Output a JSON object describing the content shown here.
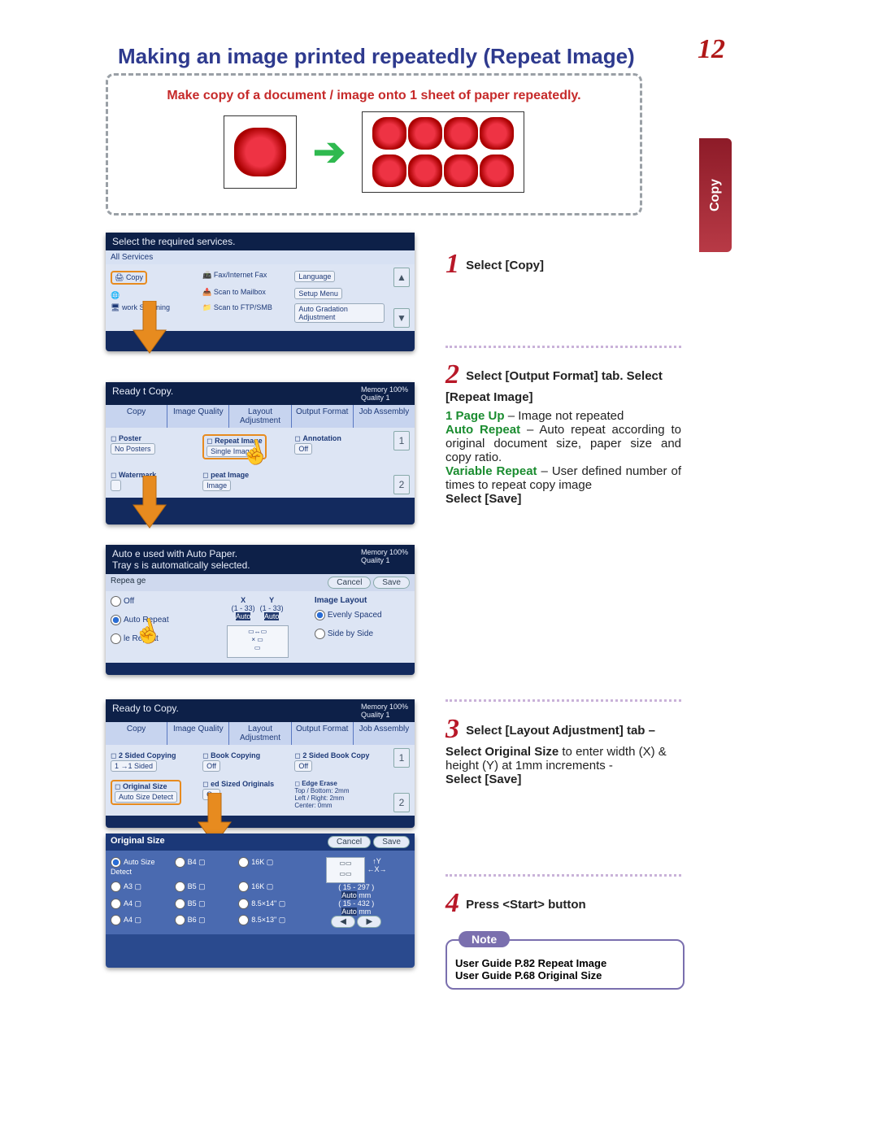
{
  "title": "Making an image printed repeatedly (Repeat Image)",
  "page_number": "12",
  "side_tab": "Copy",
  "dashed_box": {
    "heading": "Make copy of a document / image onto 1 sheet of paper repeatedly."
  },
  "panel1": {
    "header": "Select the required services.",
    "all_services": "All Services",
    "items": {
      "copy": "Copy",
      "fax": "Fax/Internet Fax",
      "language": "Language",
      "scan_mailbox": "Scan to Mailbox",
      "setup": "Setup Menu",
      "network_scan": "work Scanning",
      "scan_ftp": "Scan to FTP/SMB",
      "auto_grad": "Auto Gradation Adjustment"
    }
  },
  "panel2": {
    "header_left": "Ready t   Copy.",
    "header_right": "Memory 100%",
    "header_quality": "Quality    1",
    "tabs": [
      "Copy",
      "Image Quality",
      "Layout Adjustment",
      "Output Format",
      "Job Assembly"
    ],
    "poster": {
      "label": "Poster",
      "value": "No Posters"
    },
    "repeat_image": {
      "label": "Repeat Image",
      "value": "Single Image"
    },
    "annotation": {
      "label": "Annotation",
      "value": "Off"
    },
    "watermark": {
      "label": "Watermark"
    },
    "repeat_image2": {
      "label": "peat Image",
      "value": "Image"
    }
  },
  "panel3": {
    "header_left": "Auto          e used with Auto Paper.",
    "header_left2": "Tray s        is automatically selected.",
    "header_right": "Memory 100%",
    "header_quality": "Quality    1",
    "title_row": "Repea      ge",
    "cancel": "Cancel",
    "save": "Save",
    "x_label": "X",
    "x_range": "(1 - 33)",
    "x_value": "Auto",
    "y_label": "Y",
    "y_range": "(1 - 33)",
    "y_value": "Auto",
    "layout_label": "Image Layout",
    "off": "Off",
    "auto_repeat": "Auto Repeat",
    "le_repeat": "le Repeat",
    "evenly": "Evenly Spaced",
    "side": "Side by Side"
  },
  "panel4": {
    "header_left": "Ready to Copy.",
    "header_right": "Memory 100%",
    "header_quality": "Quality    1",
    "tabs": [
      "Copy",
      "Image Quality",
      "Layout Adjustment",
      "Output Format",
      "Job Assembly"
    ],
    "two_sided": {
      "label": "2 Sided Copying",
      "value": "1 →1 Sided"
    },
    "book": {
      "label": "Book Copying",
      "value": "Off"
    },
    "two_sided_book": {
      "label": "2 Sided Book Copy",
      "value": "Off"
    },
    "original_size": {
      "label": "Original Size",
      "value": "Auto Size Detect"
    },
    "mixed": {
      "label": "ed Sized Originals",
      "value": "On"
    },
    "edge": {
      "label": "Edge Erase",
      "value1": "Top / Bottom: 2mm",
      "value2": "Left / Right: 2mm",
      "value3": "Center: 0mm"
    }
  },
  "panel5": {
    "title": "Original Size",
    "cancel": "Cancel",
    "save": "Save",
    "options": {
      "auto": "Auto Size Detect",
      "b4": "B4 ▢",
      "a3": "A3 ▢",
      "b5": "B5 ▢",
      "a4l": "A4 ▢",
      "b5b": "B5 ▢",
      "a4p": "A4 ▢",
      "b6": "B6 ▢",
      "s16k": "16K ▢",
      "s16kp": "16K ▢",
      "s85x14": "8.5×14\" ▢",
      "s85x13": "8.5×13\" ▢"
    },
    "w_range": "( 15 - 297 )",
    "w_value": "Auto",
    "w_unit": "mm",
    "h_range": "( 15 - 432 )",
    "h_value": "Auto",
    "h_unit": "mm",
    "nav_left": "◀",
    "nav_right": "▶"
  },
  "instr1": {
    "num": "1",
    "text": "Select [Copy]"
  },
  "instr2": {
    "num": "2",
    "lead": "Select [Output Format] tab. Select [Repeat Image]",
    "page_up_label": "1 Page Up",
    "page_up_text": " – Image not repeated",
    "auto_repeat_label": "Auto Repeat",
    "auto_repeat_text": " – Auto repeat according to original document size, paper size and copy ratio.",
    "variable_label": "Variable Repeat",
    "variable_text": " – User defined number of times to repeat copy image",
    "save": "Select [Save]"
  },
  "instr3": {
    "num": "3",
    "lead": "Select [Layout Adjustment] tab – Select Original Size ",
    "tail": "to enter width (X) & height (Y) at 1mm increments -",
    "save": "Select [Save]"
  },
  "instr4": {
    "num": "4",
    "text": "Press <Start> button"
  },
  "note": {
    "badge": "Note",
    "line1": "User Guide P.82 Repeat Image",
    "line2": "User Guide P.68 Original Size"
  },
  "scroll": {
    "up_1": "1",
    "down_1": "2",
    "up_2": "1",
    "down_2": "2"
  }
}
